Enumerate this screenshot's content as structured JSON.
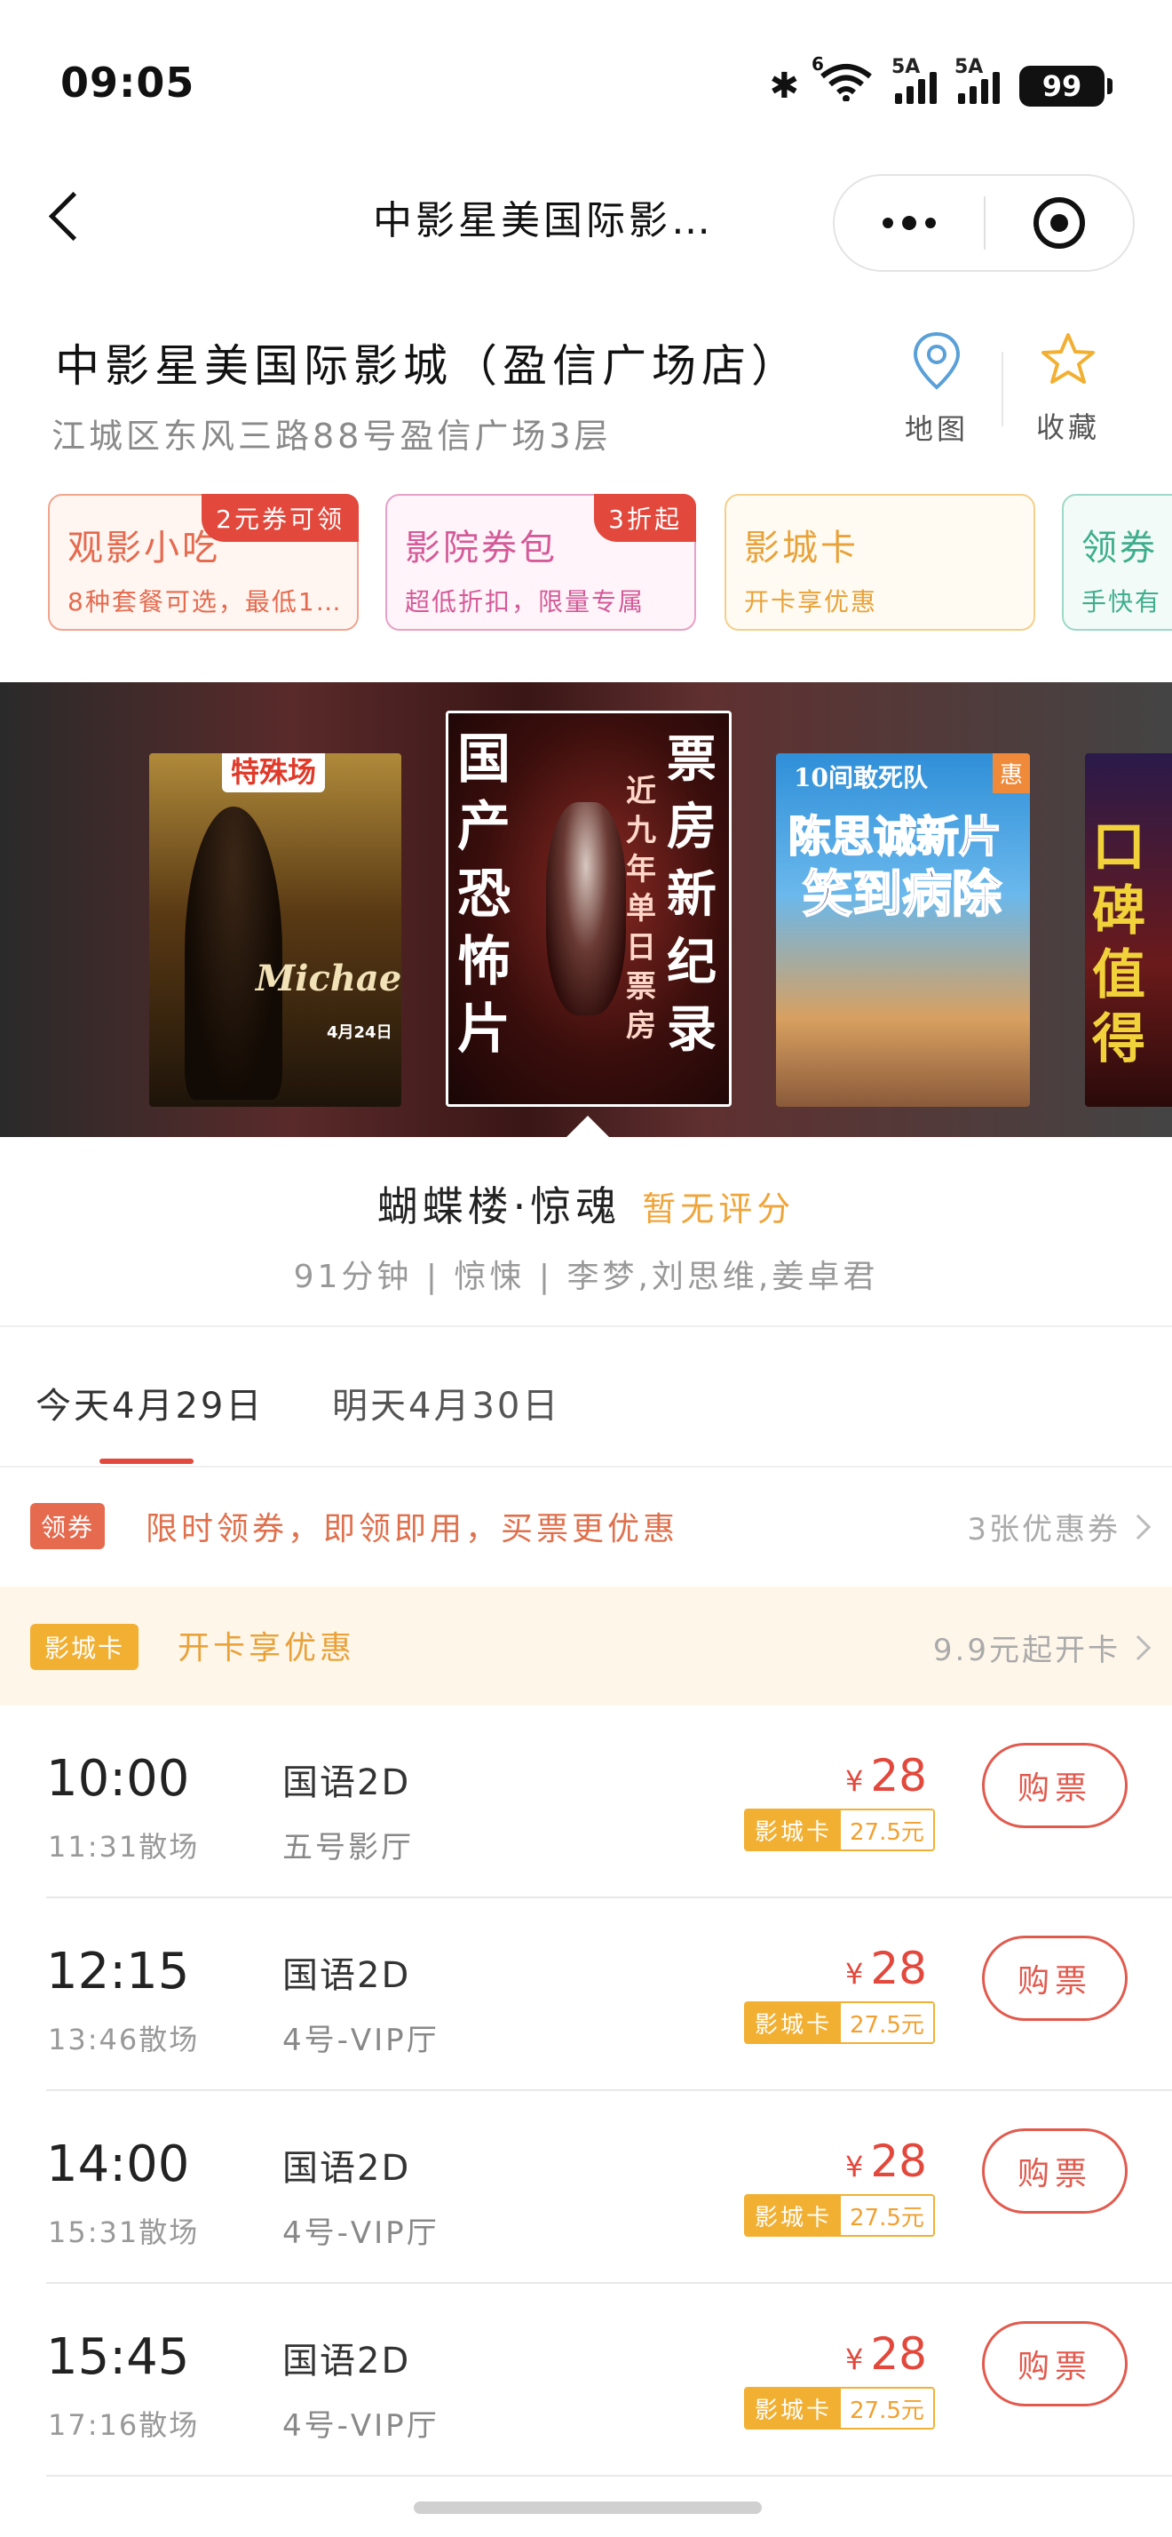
{
  "status_bar": {
    "time": "09:05",
    "wifi_label": "6",
    "signal1_label": "5A",
    "signal2_label": "5A",
    "battery": "99"
  },
  "nav": {
    "title": "中影星美国际影…"
  },
  "cinema": {
    "name": "中影星美国际影城（盈信广场店）",
    "address": "江城区东风三路88号盈信广场3层",
    "map_label": "地图",
    "favorite_label": "收藏"
  },
  "promos": [
    {
      "title": "观影小吃",
      "sub": "8种套餐可选，最低1…",
      "badge": "2元券可领"
    },
    {
      "title": "影院券包",
      "sub": "超低折扣，限量专属",
      "badge": "3折起"
    },
    {
      "title": "影城卡",
      "sub": "开卡享优惠",
      "badge": ""
    },
    {
      "title": "领券",
      "sub": "手快有",
      "badge": ""
    }
  ],
  "posters": [
    {
      "badge": "特殊场",
      "text": "Michael",
      "date": "4月24日"
    },
    {
      "left": "国产恐怖片",
      "right": "票房新纪录",
      "sub": "近九年单日票房"
    },
    {
      "top": "10间敢死队",
      "l1": "陈思诚新片",
      "l2": "笑到病除",
      "tag": "惠"
    },
    {
      "text": "口碑值得"
    }
  ],
  "movie": {
    "title": "蝴蝶楼·惊魂",
    "score": "暂无评分",
    "meta": "91分钟 | 惊悚 | 李梦,刘思维,姜卓君"
  },
  "dates": {
    "today": "今天4月29日",
    "tomorrow": "明天4月30日"
  },
  "coupon": {
    "tag": "领券",
    "text": "限时领券，即领即用，买票更优惠",
    "right": "3张优惠券"
  },
  "card": {
    "tag": "影城卡",
    "text": "开卡享优惠",
    "right": "9.9元起开卡"
  },
  "showtimes": [
    {
      "start": "10:00",
      "end": "11:31散场",
      "lang": "国语2D",
      "hall": "五号影厅",
      "price": "28",
      "card_label": "影城卡",
      "card_price": "27.5元",
      "buy": "购票"
    },
    {
      "start": "12:15",
      "end": "13:46散场",
      "lang": "国语2D",
      "hall": "4号-VIP厅",
      "price": "28",
      "card_label": "影城卡",
      "card_price": "27.5元",
      "buy": "购票"
    },
    {
      "start": "14:00",
      "end": "15:31散场",
      "lang": "国语2D",
      "hall": "4号-VIP厅",
      "price": "28",
      "card_label": "影城卡",
      "card_price": "27.5元",
      "buy": "购票"
    },
    {
      "start": "15:45",
      "end": "17:16散场",
      "lang": "国语2D",
      "hall": "4号-VIP厅",
      "price": "28",
      "card_label": "影城卡",
      "card_price": "27.5元",
      "buy": "购票"
    }
  ],
  "currency": "¥",
  "colors": {
    "accent": "#e2483c",
    "gold": "#f2b033"
  }
}
